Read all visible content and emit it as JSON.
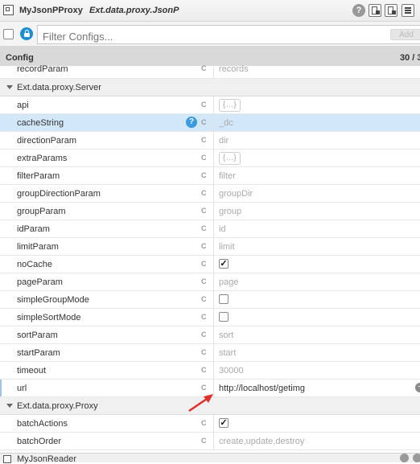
{
  "titlebar": {
    "component_name": "MyJsonPProxy",
    "class_name": "Ext.data.proxy.JsonP",
    "help_glyph": "?",
    "icons": [
      "component-icon",
      "help-icon",
      "page-back-icon",
      "page-forward-icon",
      "menu-icon"
    ]
  },
  "filter": {
    "placeholder": "Filter Configs...",
    "add_label": "Add"
  },
  "header": {
    "title": "Config",
    "count": "30 / 3"
  },
  "rows": [
    {
      "name": "recordParam",
      "value": "records"
    },
    {
      "group": "Ext.data.proxy.Server"
    },
    {
      "name": "api",
      "value": "{…}"
    },
    {
      "name": "cacheString",
      "value": "_dc"
    },
    {
      "name": "directionParam",
      "value": "dir"
    },
    {
      "name": "extraParams",
      "value": "{…}"
    },
    {
      "name": "filterParam",
      "value": "filter"
    },
    {
      "name": "groupDirectionParam",
      "value": "groupDir"
    },
    {
      "name": "groupParam",
      "value": "group"
    },
    {
      "name": "idParam",
      "value": "id"
    },
    {
      "name": "limitParam",
      "value": "limit"
    },
    {
      "name": "noCache",
      "checked": true
    },
    {
      "name": "pageParam",
      "value": "page"
    },
    {
      "name": "simpleGroupMode",
      "checked": false
    },
    {
      "name": "simpleSortMode",
      "checked": false
    },
    {
      "name": "sortParam",
      "value": "sort"
    },
    {
      "name": "startParam",
      "value": "start"
    },
    {
      "name": "timeout",
      "value": "30000"
    },
    {
      "name": "url",
      "value": "http://localhost/getimg"
    },
    {
      "group": "Ext.data.proxy.Proxy"
    },
    {
      "name": "batchActions",
      "checked": true
    },
    {
      "name": "batchOrder",
      "value": "create,update,destroy"
    }
  ],
  "config_glyph": "C",
  "check_glyph": "✓",
  "row_help_glyph": "?",
  "footer": {
    "name": "MyJsonReader"
  },
  "colors": {
    "selected_row": "#d2e7f8",
    "lock_button": "#1a8fd6",
    "arrow": "#e0302b"
  }
}
